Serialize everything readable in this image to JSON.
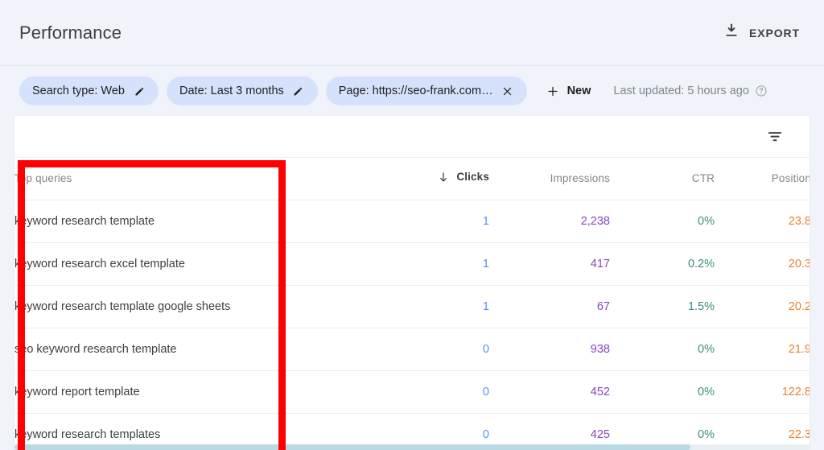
{
  "header": {
    "title": "Performance",
    "export_label": "EXPORT",
    "export_icon": "download-icon"
  },
  "filters": {
    "chips": [
      {
        "label": "Search type: Web",
        "icon": "pencil-icon",
        "action": "edit"
      },
      {
        "label": "Date: Last 3 months",
        "icon": "pencil-icon",
        "action": "edit"
      },
      {
        "label": "Page: https://seo-frank.com…",
        "icon": "close-icon",
        "action": "remove"
      }
    ],
    "new_label": "New",
    "new_icon": "plus-icon",
    "last_updated": "Last updated: 5 hours ago",
    "help_icon": "help-circle-icon"
  },
  "table": {
    "filter_icon": "filter-list-icon",
    "columns": [
      {
        "key": "query",
        "label": "Top queries",
        "align": "left",
        "sorted": false
      },
      {
        "key": "clicks",
        "label": "Clicks",
        "align": "right",
        "sorted": true,
        "sort_dir": "desc",
        "sort_icon": "arrow-down-icon"
      },
      {
        "key": "impr",
        "label": "Impressions",
        "align": "right",
        "sorted": false
      },
      {
        "key": "ctr",
        "label": "CTR",
        "align": "right",
        "sorted": false
      },
      {
        "key": "pos",
        "label": "Position",
        "align": "right",
        "sorted": false
      }
    ],
    "rows": [
      {
        "query": "keyword research template",
        "clicks": "1",
        "impressions": "2,238",
        "ctr": "0%",
        "position": "23.8"
      },
      {
        "query": "keyword research excel template",
        "clicks": "1",
        "impressions": "417",
        "ctr": "0.2%",
        "position": "20.3"
      },
      {
        "query": "keyword research template google sheets",
        "clicks": "1",
        "impressions": "67",
        "ctr": "1.5%",
        "position": "20.2"
      },
      {
        "query": "seo keyword research template",
        "clicks": "0",
        "impressions": "938",
        "ctr": "0%",
        "position": "21.9"
      },
      {
        "query": "keyword report template",
        "clicks": "0",
        "impressions": "452",
        "ctr": "0%",
        "position": "122.8"
      },
      {
        "query": "keyword research templates",
        "clicks": "0",
        "impressions": "425",
        "ctr": "0%",
        "position": "22.3"
      }
    ]
  },
  "annotation": {
    "shape": "rectangle-highlight",
    "color": "#fe0000",
    "targets": "Top queries column"
  },
  "colors": {
    "background": "#f1f3fa",
    "chip_background": "#d6e2fb",
    "clicks": "#5b8ef0",
    "impressions": "#8b45c4",
    "ctr": "#3c8c7f",
    "position": "#e8832a",
    "annotation": "#fe0000"
  }
}
